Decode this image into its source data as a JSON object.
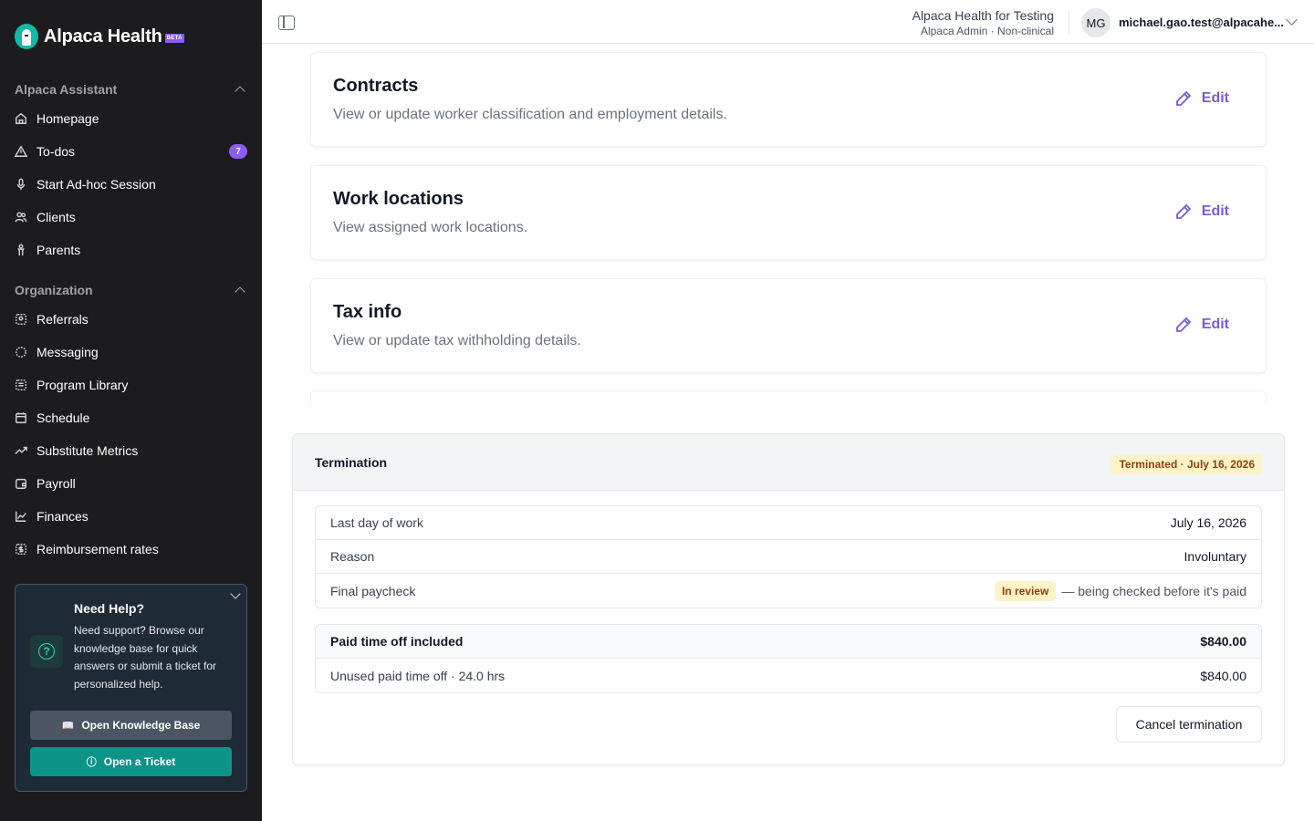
{
  "brand": {
    "name": "Alpaca Health",
    "beta": "BETA"
  },
  "sidebar": {
    "sections": [
      {
        "label": "Alpaca Assistant"
      },
      {
        "label": "Organization"
      }
    ],
    "assistant_items": [
      {
        "label": "Homepage",
        "icon": "home-icon"
      },
      {
        "label": "To-dos",
        "icon": "alert-triangle-icon",
        "badge": "7"
      },
      {
        "label": "Start Ad-hoc Session",
        "icon": "microphone-icon"
      },
      {
        "label": "Clients",
        "icon": "users-icon"
      },
      {
        "label": "Parents",
        "icon": "parent-icon"
      }
    ],
    "org_items": [
      {
        "label": "Referrals",
        "icon": "referral-icon"
      },
      {
        "label": "Messaging",
        "icon": "message-icon"
      },
      {
        "label": "Program Library",
        "icon": "library-icon"
      },
      {
        "label": "Schedule",
        "icon": "calendar-icon"
      },
      {
        "label": "Substitute Metrics",
        "icon": "trend-icon"
      },
      {
        "label": "Payroll",
        "icon": "wallet-icon"
      },
      {
        "label": "Finances",
        "icon": "chart-icon"
      },
      {
        "label": "Reimbursement rates",
        "icon": "dollar-icon"
      }
    ],
    "help": {
      "title": "Need Help?",
      "text": "Need support? Browse our knowledge base for quick answers or submit a ticket for personalized help.",
      "kb_button": "Open Knowledge Base",
      "ticket_button": "Open a Ticket"
    }
  },
  "topbar": {
    "org_name": "Alpaca Health for Testing",
    "org_role": "Alpaca Admin · Non-clinical",
    "avatar": "MG",
    "email": "michael.gao.test@alpacahe..."
  },
  "cards": [
    {
      "title": "Contracts",
      "desc": "View or update worker classification and employment details.",
      "action": "Edit"
    },
    {
      "title": "Work locations",
      "desc": "View assigned work locations.",
      "action": "Edit"
    },
    {
      "title": "Tax info",
      "desc": "View or update tax withholding details.",
      "action": "Edit"
    }
  ],
  "termination": {
    "title": "Termination",
    "status": "Terminated · July 16, 2026",
    "details": [
      {
        "label": "Last day of work",
        "value": "July 16, 2026"
      },
      {
        "label": "Reason",
        "value": "Involuntary"
      }
    ],
    "final_paycheck": {
      "label": "Final paycheck",
      "badge": "In review",
      "note": "— being checked before it's paid"
    },
    "pto": {
      "header_label": "Paid time off included",
      "header_value": "$840.00",
      "line_label": "Unused paid time off · 24.0 hrs",
      "line_value": "$840.00"
    },
    "cancel_button": "Cancel termination"
  },
  "colors": {
    "accent": "#7c5cd6",
    "teal": "#0d9488",
    "sidebar_bg": "#1c1c1e",
    "badge_purple": "#8b5cf6"
  }
}
